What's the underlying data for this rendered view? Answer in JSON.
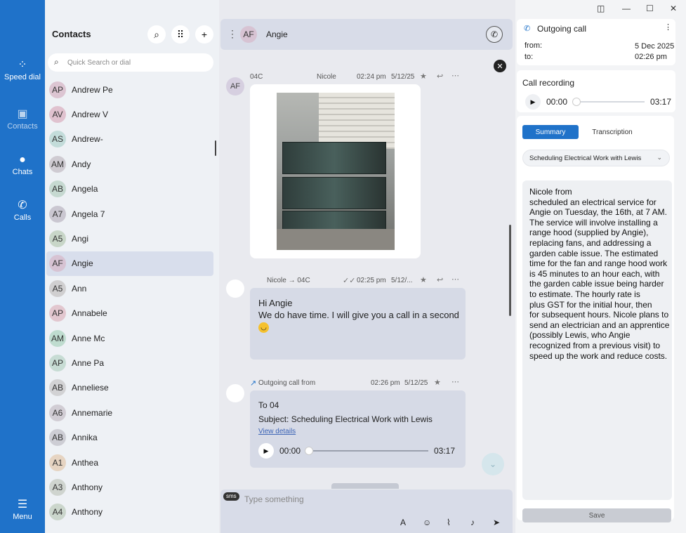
{
  "rail": {
    "speed_dial": "Speed dial",
    "contacts": "Contacts",
    "chats": "Chats",
    "calls": "Calls",
    "menu": "Menu"
  },
  "contacts": {
    "title": "Contacts",
    "search_placeholder": "Quick Search or dial",
    "items": [
      {
        "initials": "AP",
        "name": "Andrew Pe",
        "color": "#dcc5d2"
      },
      {
        "initials": "AV",
        "name": "Andrew V",
        "color": "#e0c2cf"
      },
      {
        "initials": "AS",
        "name": "Andrew-",
        "color": "#c3dcda"
      },
      {
        "initials": "AM",
        "name": "Andy",
        "color": "#cfcbd2"
      },
      {
        "initials": "AB",
        "name": "Angela",
        "color": "#c6d9d1"
      },
      {
        "initials": "A7",
        "name": "Angela 7",
        "color": "#cac7d1"
      },
      {
        "initials": "A5",
        "name": "Angi",
        "color": "#c8d6c8"
      },
      {
        "initials": "AF",
        "name": "Angie",
        "color": "#d7c3d3"
      },
      {
        "initials": "A5",
        "name": "Ann",
        "color": "#d0cfd0"
      },
      {
        "initials": "AP",
        "name": "Annabele",
        "color": "#e2c7cf"
      },
      {
        "initials": "AM",
        "name": "Anne Mc",
        "color": "#bfdccf"
      },
      {
        "initials": "AP",
        "name": "Anne Pa",
        "color": "#c7dcd4"
      },
      {
        "initials": "AB",
        "name": "Anneliese",
        "color": "#d2d2d4"
      },
      {
        "initials": "A6",
        "name": "Annemarie",
        "color": "#d1cdd4"
      },
      {
        "initials": "AB",
        "name": "Annika",
        "color": "#cdcdd4"
      },
      {
        "initials": "A1",
        "name": "Anthea",
        "color": "#e6d4c2"
      },
      {
        "initials": "A3",
        "name": "Anthony",
        "color": "#cfd4cf"
      },
      {
        "initials": "A4",
        "name": "Anthony",
        "color": "#cbd6cc"
      }
    ]
  },
  "chat": {
    "header": {
      "initials": "AF",
      "name": "Angie"
    },
    "messages": {
      "m1": {
        "from": "04C",
        "author": "Nicole",
        "time": "02:24 pm",
        "date": "5/12/25",
        "avatar": "AF"
      },
      "m2": {
        "route": "Nicole → 04C",
        "time": "02:25 pm",
        "date": "5/12/...",
        "line1": "Hi Angie",
        "line2": "We do have time. I will give you a call in a second"
      },
      "m3": {
        "type": "Outgoing call from",
        "time": "02:26 pm",
        "date": "5/12/25",
        "to": "To 04",
        "subject": "Subject: Scheduling Electrical Work with Lewis",
        "link": "View details",
        "start": "00:00",
        "end": "03:17"
      }
    },
    "composer": {
      "badge": "sms",
      "placeholder": "Type something"
    }
  },
  "right": {
    "call": {
      "title": "Outgoing call",
      "from_label": "from:",
      "to_label": "to:",
      "date": "5 Dec 2025",
      "time": "02:26 pm"
    },
    "recording": {
      "title": "Call recording",
      "start": "00:00",
      "end": "03:17"
    },
    "tabs": {
      "summary": "Summary",
      "transcription": "Transcription"
    },
    "select_value": "Scheduling Electrical Work with Lewis",
    "summary": {
      "line1": "Nicole from",
      "body": "scheduled an electrical service for Angie on Tuesday, the 16th, at 7 AM. The service will involve installing a range hood (supplied by Angie), replacing fans, and addressing a garden cable issue. The estimated time for the fan and range hood work is 45 minutes to an hour each, with the garden cable issue being harder to estimate. The hourly rate is",
      "body2": "plus GST for the initial hour, then",
      "body3": "for subsequent hours. Nicole plans to send an electrician and an apprentice (possibly Lewis, who Angie recognized from a previous visit) to speed up the work and reduce costs."
    },
    "save": "Save"
  },
  "colors": {
    "accent": "#1f72c9",
    "bubble": "#d6dae6"
  }
}
